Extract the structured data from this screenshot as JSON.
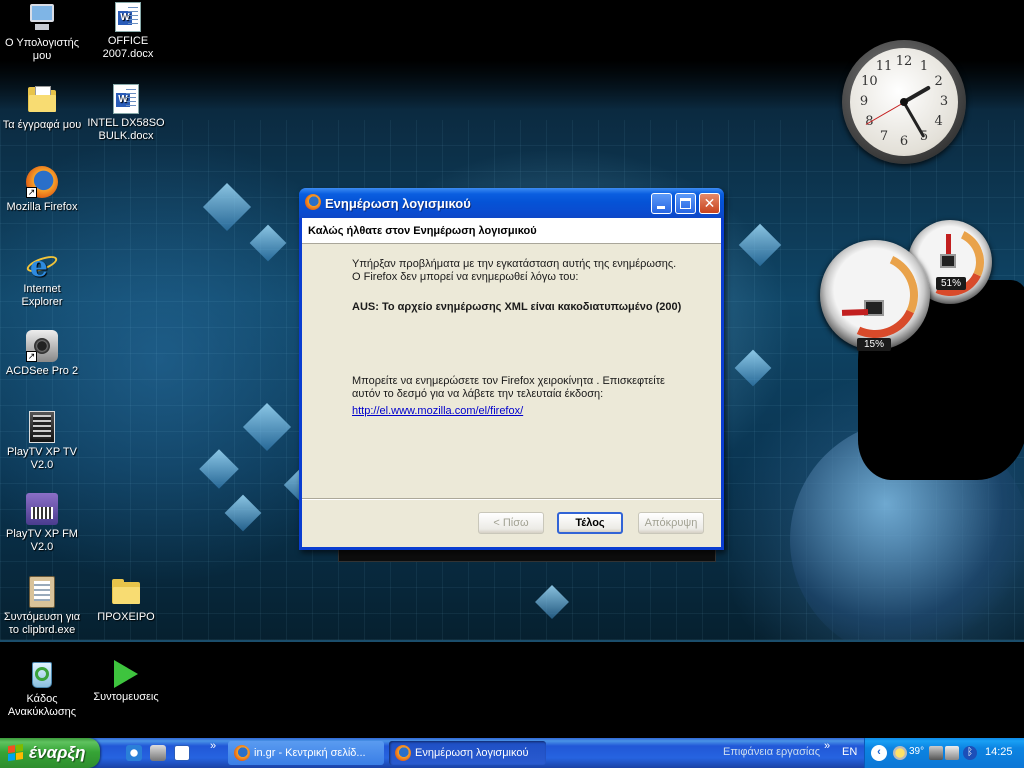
{
  "desktop": {
    "icons": [
      {
        "label": "Ο Υπολογιστής μου",
        "icon": "my-computer-icon"
      },
      {
        "label": "OFFICE 2007.docx",
        "icon": "word-document-icon"
      },
      {
        "label": "Τα έγγραφά μου",
        "icon": "my-documents-icon"
      },
      {
        "label": "INTEL DX58SO BULK.docx",
        "icon": "word-document-icon"
      },
      {
        "label": "Mozilla Firefox",
        "icon": "firefox-icon"
      },
      {
        "label": "Internet Explorer",
        "icon": "internet-explorer-icon"
      },
      {
        "label": "ACDSee Pro 2",
        "icon": "acdsee-icon"
      },
      {
        "label": "PlayTV XP TV V2.0",
        "icon": "playtv-tv-icon"
      },
      {
        "label": "PlayTV XP FM V2.0",
        "icon": "playtv-fm-icon"
      },
      {
        "label": "Συντόμευση για το clipbrd.exe",
        "icon": "clipboard-icon"
      },
      {
        "label": "ΠΡΟΧΕΙΡΟ",
        "icon": "folder-icon"
      },
      {
        "label": "Κάδος Ανακύκλωσης",
        "icon": "recycle-bin-icon"
      },
      {
        "label": "Συντομευσεις",
        "icon": "play-arrow-icon"
      }
    ]
  },
  "gadgets": {
    "clock": {
      "numbers": [
        "12",
        "1",
        "2",
        "3",
        "4",
        "5",
        "6",
        "7",
        "8",
        "9",
        "10",
        "11"
      ]
    },
    "cpu_meter": {
      "cpu_percent": "15%",
      "ram_percent": "51%",
      "cpu_value": 15,
      "ram_value": 51
    }
  },
  "dialog": {
    "title": "Ενημέρωση λογισμικού",
    "header": "Καλώς ήλθατε στον Ενημέρωση λογισμικού",
    "message_line1": "Υπήρξαν προβλήματα με την εγκατάσταση αυτής της ενημέρωσης.",
    "message_line2": "Ο Firefox δεν μπορεί να ενημερωθεί λόγω του:",
    "error_text": "AUS: Το αρχείο ενημέρωσης XML είναι κακοδιατυπωμένο (200)",
    "manual_line1": "Μπορείτε να ενημερώσετε τον Firefox χειροκίνητα . Επισκεφτείτε",
    "manual_line2": "αυτόν το δεσμό για να λάβετε την τελευταία έκδοση:",
    "link": "http://el.www.mozilla.com/el/firefox/",
    "buttons": {
      "back": "< Πίσω",
      "finish": "Τέλος",
      "cancel": "Απόκρυψη"
    }
  },
  "taskbar": {
    "start_label": "έναρξη",
    "tasks": [
      {
        "label": "in.gr - Κεντρική σελίδ...",
        "active": false
      },
      {
        "label": "Ενημέρωση λογισμικού",
        "active": true
      }
    ],
    "desktop_toolbar": "Επιφάνεια εργασίας",
    "more_glyph": "»",
    "language": "EN",
    "temperature": "39°",
    "time": "14:25"
  },
  "colors": {
    "taskbar_blue": "#2663e0",
    "start_green": "#36a436",
    "tray_blue": "#0c84e2",
    "dialog_face": "#ece9d8",
    "link": "#0000cc"
  }
}
